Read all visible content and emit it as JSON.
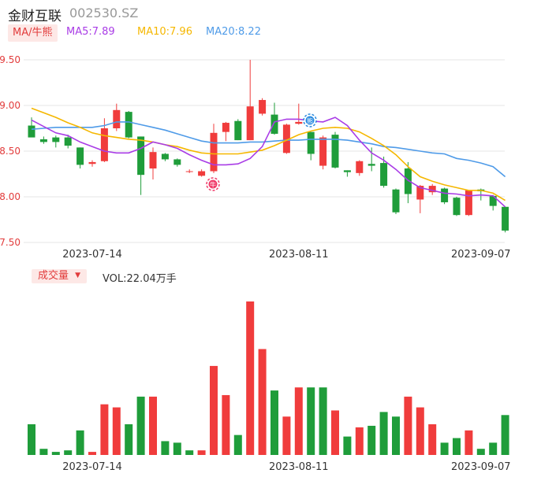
{
  "header": {
    "name": "金财互联",
    "code": "002530.SZ"
  },
  "ma_legend": {
    "tab_label": "MA/牛熊",
    "items": [
      {
        "text": "MA5:7.89",
        "color": "#a93ce6"
      },
      {
        "text": "MA10:7.96",
        "color": "#f5b700"
      },
      {
        "text": "MA20:8.22",
        "color": "#4f9be8"
      }
    ]
  },
  "volume_header": {
    "tab_label": "成交量",
    "dropdown_icon": "triangle-down-icon",
    "value_text": "VOL:22.04万手"
  },
  "markers": {
    "ma_buy": {
      "glyph": "牛",
      "icon": "bull-icon"
    },
    "ma_sell": {
      "glyph": "熊",
      "icon": "bear-icon"
    }
  },
  "colors": {
    "up": "#f03c3c",
    "down": "#1f9d3a",
    "ma5": "#a93ce6",
    "ma10": "#f5b700",
    "ma20": "#4f9be8",
    "price_axis": "#e23c3c",
    "grid": "#e6e6e6"
  },
  "chart_data": [
    {
      "type": "candlestick",
      "title": "",
      "y_ticks": [
        "9.50",
        "9.00",
        "8.50",
        "8.00",
        "7.50"
      ],
      "ylim": [
        7.5,
        9.5
      ],
      "x_tick_labels": [
        "2023-07-14",
        "2023-08-11",
        "2023-09-07"
      ],
      "x_tick_indices": [
        5,
        22,
        37
      ],
      "grid": true,
      "candles": [
        {
          "open": 8.78,
          "high": 8.87,
          "low": 8.68,
          "close": 8.65
        },
        {
          "open": 8.63,
          "high": 8.66,
          "low": 8.58,
          "close": 8.6
        },
        {
          "open": 8.65,
          "high": 8.67,
          "low": 8.54,
          "close": 8.6
        },
        {
          "open": 8.65,
          "high": 8.68,
          "low": 8.53,
          "close": 8.56
        },
        {
          "open": 8.54,
          "high": 8.54,
          "low": 8.31,
          "close": 8.35
        },
        {
          "open": 8.36,
          "high": 8.4,
          "low": 8.33,
          "close": 8.38
        },
        {
          "open": 8.39,
          "high": 8.86,
          "low": 8.38,
          "close": 8.75
        },
        {
          "open": 8.75,
          "high": 9.02,
          "low": 8.72,
          "close": 8.95
        },
        {
          "open": 8.93,
          "high": 8.94,
          "low": 8.64,
          "close": 8.65
        },
        {
          "open": 8.66,
          "high": 8.66,
          "low": 8.02,
          "close": 8.24
        },
        {
          "open": 8.31,
          "high": 8.54,
          "low": 8.19,
          "close": 8.49
        },
        {
          "open": 8.47,
          "high": 8.48,
          "low": 8.39,
          "close": 8.41
        },
        {
          "open": 8.41,
          "high": 8.42,
          "low": 8.33,
          "close": 8.35
        },
        {
          "open": 8.28,
          "high": 8.3,
          "low": 8.26,
          "close": 8.28
        },
        {
          "open": 8.23,
          "high": 8.3,
          "low": 8.22,
          "close": 8.28
        },
        {
          "open": 8.28,
          "high": 8.8,
          "low": 8.26,
          "close": 8.7
        },
        {
          "open": 8.71,
          "high": 8.82,
          "low": 8.61,
          "close": 8.81
        },
        {
          "open": 8.83,
          "high": 8.85,
          "low": 8.62,
          "close": 8.62
        },
        {
          "open": 8.62,
          "high": 9.5,
          "low": 8.62,
          "close": 8.99
        },
        {
          "open": 8.91,
          "high": 9.08,
          "low": 8.89,
          "close": 9.06
        },
        {
          "open": 8.9,
          "high": 9.03,
          "low": 8.68,
          "close": 8.69
        },
        {
          "open": 8.48,
          "high": 8.8,
          "low": 8.47,
          "close": 8.79
        },
        {
          "open": 8.8,
          "high": 9.02,
          "low": 8.79,
          "close": 8.82
        },
        {
          "open": 8.71,
          "high": 8.71,
          "low": 8.4,
          "close": 8.47
        },
        {
          "open": 8.34,
          "high": 8.67,
          "low": 8.3,
          "close": 8.65
        },
        {
          "open": 8.68,
          "high": 8.71,
          "low": 8.31,
          "close": 8.32
        },
        {
          "open": 8.29,
          "high": 8.29,
          "low": 8.22,
          "close": 8.27
        },
        {
          "open": 8.26,
          "high": 8.4,
          "low": 8.23,
          "close": 8.39
        },
        {
          "open": 8.36,
          "high": 8.54,
          "low": 8.28,
          "close": 8.34
        },
        {
          "open": 8.37,
          "high": 8.44,
          "low": 8.1,
          "close": 8.12
        },
        {
          "open": 8.08,
          "high": 8.09,
          "low": 7.81,
          "close": 7.83
        },
        {
          "open": 8.31,
          "high": 8.38,
          "low": 7.93,
          "close": 8.03
        },
        {
          "open": 7.97,
          "high": 8.13,
          "low": 7.82,
          "close": 8.12
        },
        {
          "open": 8.05,
          "high": 8.14,
          "low": 8.02,
          "close": 8.12
        },
        {
          "open": 8.09,
          "high": 8.1,
          "low": 7.92,
          "close": 7.94
        },
        {
          "open": 7.99,
          "high": 8.0,
          "low": 7.79,
          "close": 7.8
        },
        {
          "open": 7.8,
          "high": 8.07,
          "low": 7.79,
          "close": 8.07
        },
        {
          "open": 8.08,
          "high": 8.09,
          "low": 7.96,
          "close": 8.06
        },
        {
          "open": 8.01,
          "high": 8.02,
          "low": 7.85,
          "close": 7.9
        },
        {
          "open": 7.89,
          "high": 7.89,
          "low": 7.61,
          "close": 7.63
        }
      ],
      "ma5": [
        8.84,
        8.77,
        8.7,
        8.67,
        8.6,
        8.55,
        8.5,
        8.48,
        8.48,
        8.53,
        8.6,
        8.57,
        8.53,
        8.46,
        8.4,
        8.35,
        8.35,
        8.36,
        8.42,
        8.55,
        8.82,
        8.85,
        8.85,
        8.83,
        8.82,
        8.87,
        8.78,
        8.62,
        8.48,
        8.4,
        8.3,
        8.18,
        8.1,
        8.07,
        8.04,
        8.03,
        8.01,
        8.02,
        8.01,
        7.89
      ],
      "ma10": [
        8.97,
        8.92,
        8.87,
        8.81,
        8.76,
        8.7,
        8.67,
        8.65,
        8.63,
        8.62,
        8.6,
        8.57,
        8.55,
        8.51,
        8.48,
        8.47,
        8.47,
        8.47,
        8.49,
        8.51,
        8.56,
        8.62,
        8.68,
        8.72,
        8.75,
        8.76,
        8.75,
        8.71,
        8.64,
        8.56,
        8.46,
        8.33,
        8.22,
        8.17,
        8.13,
        8.1,
        8.07,
        8.07,
        8.04,
        7.96
      ],
      "ma20": [
        8.74,
        8.75,
        8.76,
        8.76,
        8.76,
        8.76,
        8.78,
        8.82,
        8.82,
        8.79,
        8.76,
        8.73,
        8.69,
        8.65,
        8.61,
        8.59,
        8.59,
        8.59,
        8.6,
        8.6,
        8.61,
        8.62,
        8.62,
        8.63,
        8.63,
        8.63,
        8.62,
        8.6,
        8.58,
        8.55,
        8.54,
        8.52,
        8.5,
        8.48,
        8.47,
        8.42,
        8.4,
        8.37,
        8.33,
        8.22
      ]
    },
    {
      "type": "bar",
      "title": "",
      "series_name": "VOL",
      "x_tick_labels": [
        "2023-07-14",
        "2023-08-11",
        "2023-09-07"
      ],
      "x_tick_indices": [
        5,
        22,
        37
      ],
      "values": [
        0.2,
        0.04,
        0.02,
        0.03,
        0.16,
        0.02,
        0.33,
        0.31,
        0.2,
        0.38,
        0.38,
        0.09,
        0.08,
        0.03,
        0.03,
        0.58,
        0.39,
        0.13,
        1.0,
        0.69,
        0.42,
        0.25,
        0.44,
        0.44,
        0.44,
        0.29,
        0.12,
        0.18,
        0.19,
        0.28,
        0.25,
        0.38,
        0.31,
        0.2,
        0.08,
        0.11,
        0.16,
        0.04,
        0.08,
        0.26
      ],
      "direction": [
        "down",
        "down",
        "down",
        "down",
        "down",
        "up",
        "up",
        "up",
        "down",
        "down",
        "up",
        "down",
        "down",
        "down",
        "up",
        "up",
        "up",
        "down",
        "up",
        "up",
        "down",
        "up",
        "up",
        "down",
        "down",
        "up",
        "down",
        "up",
        "down",
        "down",
        "down",
        "up",
        "up",
        "up",
        "down",
        "down",
        "up",
        "down",
        "down",
        "down"
      ]
    }
  ]
}
